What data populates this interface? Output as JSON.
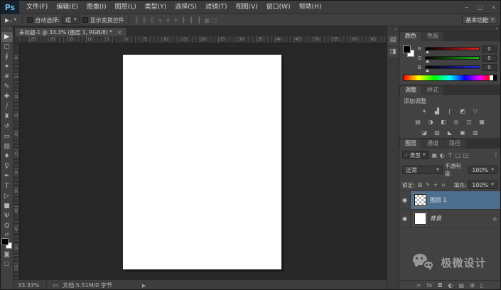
{
  "menu": {
    "logo": "Ps",
    "items": [
      "文件(F)",
      "编辑(E)",
      "图像(I)",
      "图层(L)",
      "类型(Y)",
      "选择(S)",
      "滤镜(T)",
      "视图(V)",
      "窗口(W)",
      "帮助(H)"
    ]
  },
  "window": {
    "controls": [
      {
        "name": "minimize-button",
        "glyph": "─"
      },
      {
        "name": "maximize-button",
        "glyph": "□"
      },
      {
        "name": "close-button",
        "glyph": "×"
      }
    ]
  },
  "options_bar": {
    "move_tool_glyph": "▶₊",
    "auto_select_label": "自动选择:",
    "auto_select_value": "组",
    "show_transform_label": "显示变换控件",
    "workspace_label": "基本功能",
    "align_icons": [
      {
        "name": "align-left-edges-icon",
        "glyph": "╟"
      },
      {
        "name": "align-horizontal-centers-icon",
        "glyph": "╫"
      },
      {
        "name": "align-right-edges-icon",
        "glyph": "╢"
      },
      {
        "name": "align-top-edges-icon",
        "glyph": "┯"
      },
      {
        "name": "align-vertical-centers-icon",
        "glyph": "┿"
      },
      {
        "name": "align-bottom-edges-icon",
        "glyph": "┷"
      },
      {
        "name": "distribute-left-edges-icon",
        "glyph": "┠"
      },
      {
        "name": "distribute-horizontal-centers-icon",
        "glyph": "╂"
      },
      {
        "name": "distribute-right-edges-icon",
        "glyph": "┨"
      },
      {
        "name": "auto-align-layers-icon",
        "glyph": "▦"
      },
      {
        "name": "arrange-3d-icon",
        "glyph": "◳"
      }
    ]
  },
  "toolbar": {
    "collapse_glyph": "»",
    "swap_glyph": "⇄",
    "quick_mask_glyph": "◙",
    "screen_mode_glyph": "▢"
  },
  "tools": [
    {
      "name": "move-tool",
      "glyph": "▶",
      "selected": true
    },
    {
      "name": "rectangular-marquee-tool",
      "glyph": "▢"
    },
    {
      "name": "lasso-tool",
      "glyph": "∮"
    },
    {
      "name": "quick-selection-tool",
      "glyph": "✦"
    },
    {
      "name": "crop-tool",
      "glyph": "#"
    },
    {
      "name": "eyedropper-tool",
      "glyph": "✎"
    },
    {
      "name": "spot-healing-brush-tool",
      "glyph": "✚"
    },
    {
      "name": "brush-tool",
      "glyph": "∕"
    },
    {
      "name": "clone-stamp-tool",
      "glyph": "♜"
    },
    {
      "name": "history-brush-tool",
      "glyph": "↺"
    },
    {
      "name": "eraser-tool",
      "glyph": "▭"
    },
    {
      "name": "gradient-tool",
      "glyph": "▥"
    },
    {
      "name": "blur-tool",
      "glyph": "♦"
    },
    {
      "name": "dodge-tool",
      "glyph": "♀"
    },
    {
      "name": "pen-tool",
      "glyph": "✒"
    },
    {
      "name": "type-tool",
      "glyph": "T"
    },
    {
      "name": "path-selection-tool",
      "glyph": "▷"
    },
    {
      "name": "rectangle-tool",
      "glyph": "■"
    },
    {
      "name": "hand-tool",
      "glyph": "Ψ"
    },
    {
      "name": "zoom-tool",
      "glyph": "Q"
    }
  ],
  "doc_tab": {
    "title": "未标题-1 @ 33.3% (图层 1, RGB/8) *",
    "close_glyph": "×"
  },
  "rulers": {
    "h_labels": [
      "25",
      "20",
      "15",
      "10",
      "5",
      "0",
      "5",
      "10",
      "15",
      "20",
      "25",
      "30",
      "35",
      "40",
      "45",
      "50",
      "55",
      "60",
      "65"
    ],
    "v_labels": [
      "0",
      "5",
      "10",
      "15",
      "20",
      "25",
      "30",
      "35",
      "40",
      "45",
      "50",
      "55",
      "60"
    ]
  },
  "dock": {
    "collapse_glyph": "«",
    "icons": [
      {
        "name": "history-panel-icon",
        "glyph": "▤"
      },
      {
        "name": "properties-panel-icon",
        "glyph": "◨"
      }
    ]
  },
  "panels_header": {
    "collapse_glyph": "»"
  },
  "color_panel": {
    "tabs": [
      {
        "label": "颜色",
        "active": true
      },
      {
        "label": "色板"
      }
    ],
    "menu_glyph": "≡",
    "channels": [
      {
        "label": "R",
        "value": "0",
        "cls": "r"
      },
      {
        "label": "G",
        "value": "0",
        "cls": "g"
      },
      {
        "label": "B",
        "value": "0",
        "cls": "b"
      }
    ]
  },
  "adjustments_panel": {
    "tabs": [
      {
        "label": "调整",
        "active": true
      },
      {
        "label": "样式"
      }
    ],
    "menu_glyph": "≡",
    "heading": "添加调整",
    "row1": [
      {
        "name": "brightness-contrast-icon",
        "glyph": "☀"
      },
      {
        "name": "levels-icon",
        "glyph": "▟"
      },
      {
        "name": "curves-icon",
        "glyph": "ʃ"
      },
      {
        "name": "exposure-icon",
        "glyph": "◩"
      },
      {
        "name": "vibrance-icon",
        "glyph": "▽"
      }
    ],
    "row2": [
      {
        "name": "hue-saturation-icon",
        "glyph": "▤"
      },
      {
        "name": "color-balance-icon",
        "glyph": "◑"
      },
      {
        "name": "black-white-icon",
        "glyph": "◧"
      },
      {
        "name": "photo-filter-icon",
        "glyph": "◎"
      },
      {
        "name": "channel-mixer-icon",
        "glyph": "◫"
      },
      {
        "name": "color-lookup-icon",
        "glyph": "▦"
      }
    ],
    "row3": [
      {
        "name": "invert-icon",
        "glyph": "◪"
      },
      {
        "name": "posterize-icon",
        "glyph": "▨"
      },
      {
        "name": "threshold-icon",
        "glyph": "◣"
      },
      {
        "name": "selective-color-icon",
        "glyph": "▣"
      },
      {
        "name": "gradient-map-icon",
        "glyph": "▥"
      }
    ]
  },
  "layers_panel": {
    "tabs": [
      {
        "label": "图层",
        "active": true
      },
      {
        "label": "通道"
      },
      {
        "label": "路径"
      }
    ],
    "menu_glyph": "≡",
    "filter": {
      "search_glyph": "⌕",
      "kind_label": "类型",
      "icons": [
        {
          "name": "filter-pixel-layers-icon",
          "glyph": "▣"
        },
        {
          "name": "filter-adjustment-layers-icon",
          "glyph": "◐"
        },
        {
          "name": "filter-type-layers-icon",
          "glyph": "T"
        },
        {
          "name": "filter-shape-layers-icon",
          "glyph": "▢"
        },
        {
          "name": "filter-smart-objects-icon",
          "glyph": "◳"
        }
      ]
    },
    "blend_mode": "正常",
    "opacity_label": "不透明度:",
    "opacity_value": "100%",
    "lock_label": "锁定:",
    "lock_icons": [
      {
        "name": "lock-transparent-pixels-icon",
        "glyph": "▨"
      },
      {
        "name": "lock-image-pixels-icon",
        "glyph": "✎"
      },
      {
        "name": "lock-position-icon",
        "glyph": "+"
      },
      {
        "name": "lock-all-icon",
        "glyph": "⌂"
      }
    ],
    "fill_label": "填充:",
    "fill_value": "100%",
    "eye_glyph": "◉",
    "rows": [
      {
        "name": "图层 1",
        "selected": true,
        "thumb": "checker"
      },
      {
        "name": "背景",
        "italic": true,
        "thumb": "white",
        "lock_glyph": "⌂"
      }
    ],
    "buttons": [
      {
        "name": "link-layers-button",
        "glyph": "∞"
      },
      {
        "name": "layer-style-button",
        "glyph": "fx"
      },
      {
        "name": "add-layer-mask-button",
        "glyph": "◘"
      },
      {
        "name": "new-adjustment-layer-button",
        "glyph": "◐"
      },
      {
        "name": "new-group-button",
        "glyph": "▤"
      },
      {
        "name": "new-layer-button",
        "glyph": "⊞"
      },
      {
        "name": "delete-layer-button",
        "glyph": "▯"
      }
    ]
  },
  "watermark": {
    "text": "极微设计"
  },
  "status_bar": {
    "zoom": "33.33%",
    "doc_icon_glyph": "▭",
    "doc_label": "文档:5.51M/0 字节",
    "arrow_glyph": "▶"
  },
  "colors": {
    "accent_selected_layer": "#4e6e8e",
    "canvas_bg": "#272727",
    "panel_bg": "#424242"
  }
}
